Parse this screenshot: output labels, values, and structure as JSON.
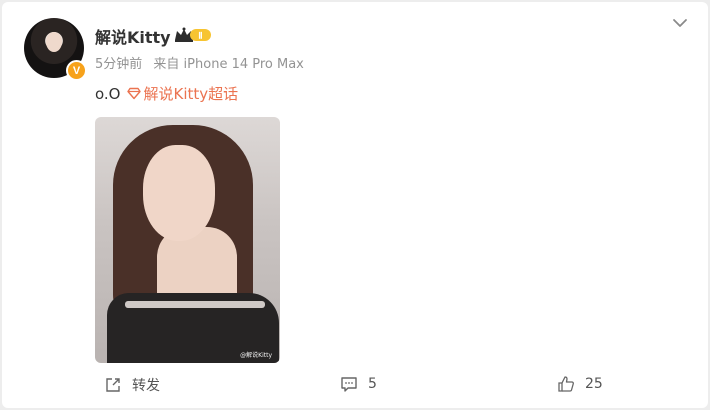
{
  "post": {
    "user": {
      "name": "解说Kitty",
      "verified_glyph": "V",
      "rank_glyph": "Ⅱ",
      "avatar_icon": "avatar-photo"
    },
    "meta": {
      "time": "5分钟前",
      "source": "来自 iPhone 14 Pro Max"
    },
    "content": {
      "text": "o.O",
      "topic_icon": "diamond-icon",
      "topic": "解说Kitty超话"
    },
    "image": {
      "watermark": "@解说Kitty"
    },
    "actions": {
      "share_label": "转发",
      "comment_count": "5",
      "like_count": "25"
    },
    "colors": {
      "topic": "#eb7350",
      "badge": "#f7a21b",
      "text": "#333333",
      "meta": "#939393"
    }
  }
}
